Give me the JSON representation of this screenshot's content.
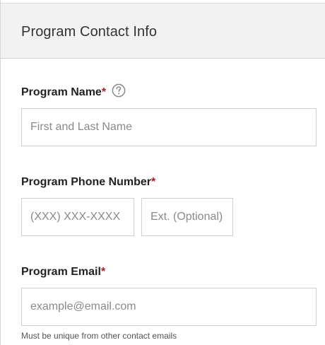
{
  "section": {
    "title": "Program Contact Info"
  },
  "program_name": {
    "label": "Program Name",
    "required_marker": "*",
    "placeholder": "First and Last Name",
    "value": "",
    "help_icon": "question-circle-icon"
  },
  "program_phone": {
    "label": "Program Phone Number",
    "required_marker": "*",
    "number_placeholder": "(XXX) XXX-XXXX",
    "number_value": "",
    "ext_placeholder": "Ext. (Optional)",
    "ext_value": ""
  },
  "program_email": {
    "label": "Program Email",
    "required_marker": "*",
    "placeholder": "example@email.com",
    "value": "",
    "hint": "Must be unique from other contact emails"
  },
  "colors": {
    "required": "#b0182b",
    "header_bg": "#f2f2f2",
    "border": "#cfcfcf"
  }
}
